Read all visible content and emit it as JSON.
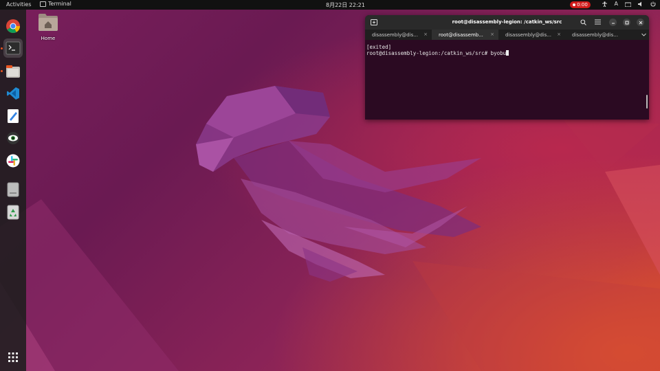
{
  "topbar": {
    "activities": "Activities",
    "app_name": "Terminal",
    "clock": "8月22日  22:21",
    "recording": "0:00",
    "input_method": "A"
  },
  "desktop": {
    "home_label": "Home"
  },
  "dock": {
    "items": [
      "chrome-icon",
      "terminal-icon",
      "files-icon",
      "vscode-icon",
      "text-editor-icon",
      "eye-app-icon",
      "slack-icon",
      "disk-icon",
      "trash-icon",
      "app-grid-icon"
    ]
  },
  "terminal": {
    "title": "root@disassembly-legion: /catkin_ws/src",
    "tabs": [
      {
        "label": "disassembly@dis..."
      },
      {
        "label": "root@disassemb..."
      },
      {
        "label": "disassembly@dis..."
      },
      {
        "label": "disassembly@dis..."
      }
    ],
    "lines": [
      "[exited]",
      "root@disassembly-legion:/catkin_ws/src# byobu"
    ]
  },
  "colors": {
    "accent": "#e95420",
    "terminal_bg": "#2b0a22"
  }
}
